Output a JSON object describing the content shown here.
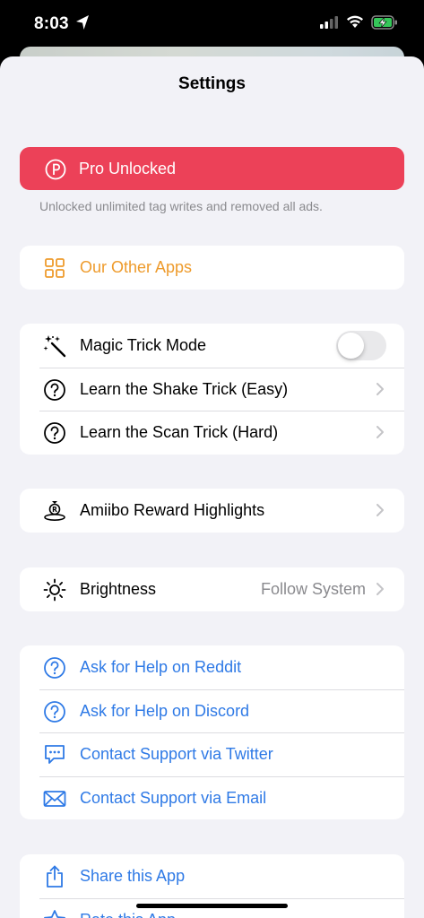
{
  "status_bar": {
    "time": "8:03"
  },
  "title": "Settings",
  "pro": {
    "label": "Pro Unlocked",
    "footer": "Unlocked unlimited tag writes and removed all ads."
  },
  "other_apps": {
    "label": "Our Other Apps"
  },
  "magic": {
    "toggle_label": "Magic Trick Mode",
    "toggle_on": false,
    "shake": "Learn the Shake Trick (Easy)",
    "scan": "Learn the Scan Trick (Hard)"
  },
  "amiibo": {
    "label": "Amiibo Reward Highlights"
  },
  "brightness": {
    "label": "Brightness",
    "value": "Follow System"
  },
  "help": {
    "reddit": "Ask for Help on Reddit",
    "discord": "Ask for Help on Discord",
    "twitter": "Contact Support via Twitter",
    "email": "Contact Support via Email"
  },
  "share": {
    "share_label": "Share this App",
    "rate_label": "Rate this App"
  },
  "colors": {
    "accent_blue": "#2f7ae6",
    "orange": "#ee9b2c",
    "pro_red": "#ec4158",
    "background": "#f2f2f7"
  }
}
